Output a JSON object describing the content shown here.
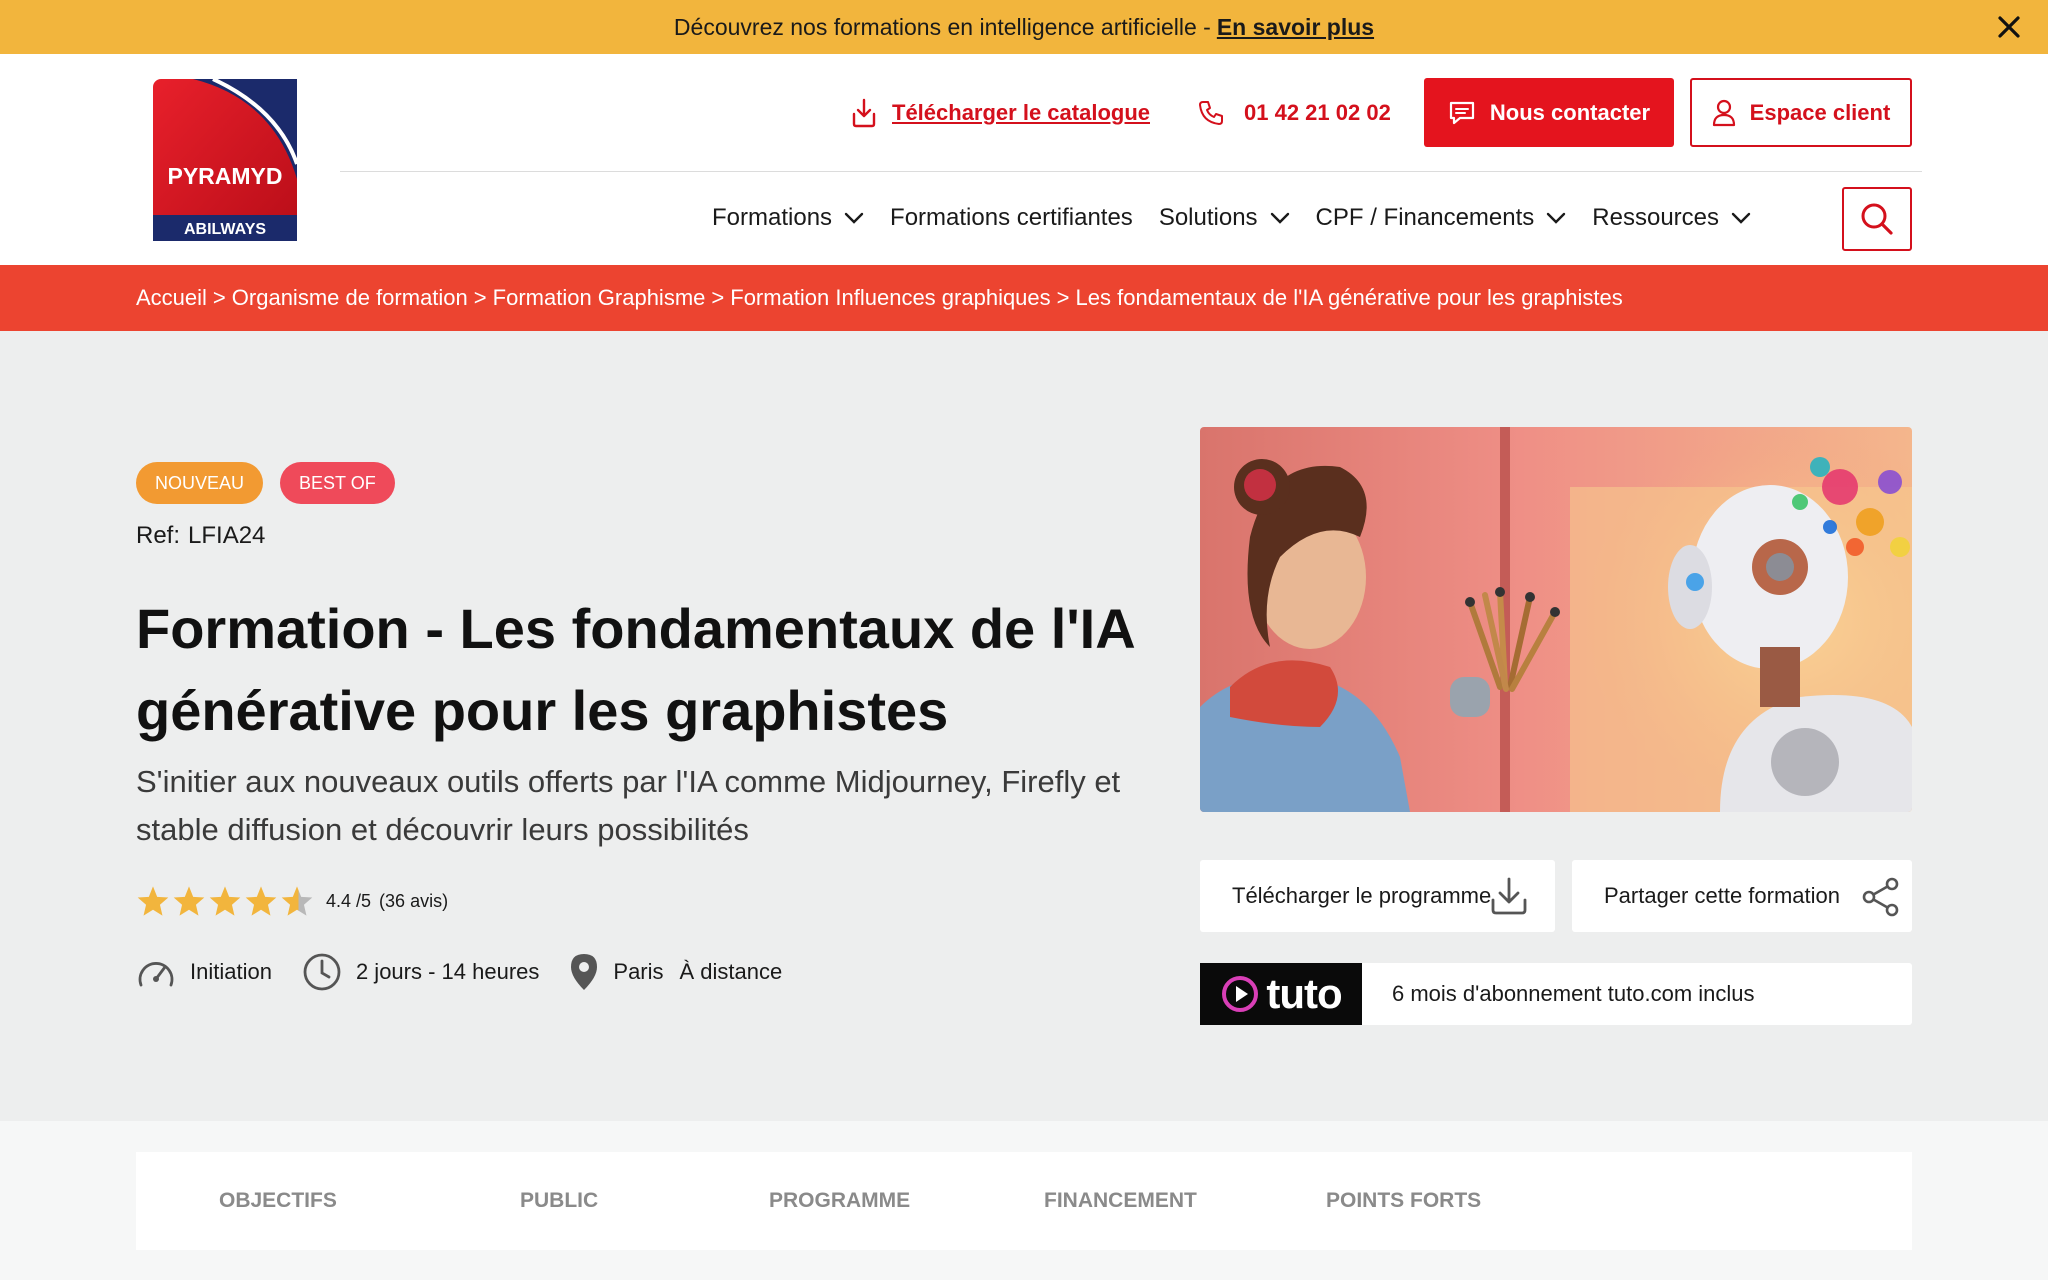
{
  "announcement": {
    "text": "Découvrez nos formations en intelligence artificielle -",
    "link": "En savoir plus",
    "close_icon": "close-icon"
  },
  "header": {
    "logo": {
      "brand": "PYRAMYD",
      "sub": "ABILWAYS",
      "colors": {
        "red": "#d4101c",
        "navy": "#1b2a6b"
      }
    },
    "catalog_link": "Télécharger le catalogue",
    "phone": "01 42 21 02 02",
    "contact_button": "Nous contacter",
    "client_button": "Espace client",
    "nav": [
      {
        "label": "Formations",
        "has_dropdown": true
      },
      {
        "label": "Formations certifiantes",
        "has_dropdown": false
      },
      {
        "label": "Solutions",
        "has_dropdown": true
      },
      {
        "label": "CPF / Financements",
        "has_dropdown": true
      },
      {
        "label": "Ressources",
        "has_dropdown": true
      }
    ],
    "search_icon": "search-icon"
  },
  "breadcrumb": [
    "Accueil",
    "Organisme de formation",
    "Formation Graphisme",
    "Formation Influences graphiques",
    "Les fondamentaux de l'IA générative pour les graphistes"
  ],
  "breadcrumb_separator": ">",
  "hero": {
    "badges": [
      "NOUVEAU",
      "BEST OF"
    ],
    "ref_label": "Ref:",
    "ref_value": "LFIA24",
    "title": "Formation - Les fondamentaux de l'IA générative pour les graphistes",
    "subtitle": "S'initier aux nouveaux outils offerts par l'IA comme Midjourney, Firefly et stable diffusion et découvrir leurs possibilités",
    "rating": {
      "stars": 4.4,
      "max": 5,
      "score_text": "4.4 /5",
      "reviews_text": "(36 avis)"
    },
    "level": "Initiation",
    "duration": "2 jours - 14 heures",
    "location": "Paris",
    "location_remote": "À distance"
  },
  "side": {
    "download_program": "Télécharger le programme",
    "share": "Partager cette formation",
    "tuto_logo": "tuto",
    "tuto_text": "6 mois d'abonnement tuto.com inclus"
  },
  "tabs": [
    "OBJECTIFS",
    "PUBLIC",
    "PROGRAMME",
    "FINANCEMENT",
    "POINTS FORTS"
  ],
  "colors": {
    "announce_bg": "#f2b53d",
    "brand_red": "#e4141e",
    "breadcrumb_bg": "#ec4430",
    "hero_bg": "#edeeee",
    "badge_new": "#f29a32",
    "badge_best": "#ef4a5a",
    "star": "#f2b53d"
  }
}
